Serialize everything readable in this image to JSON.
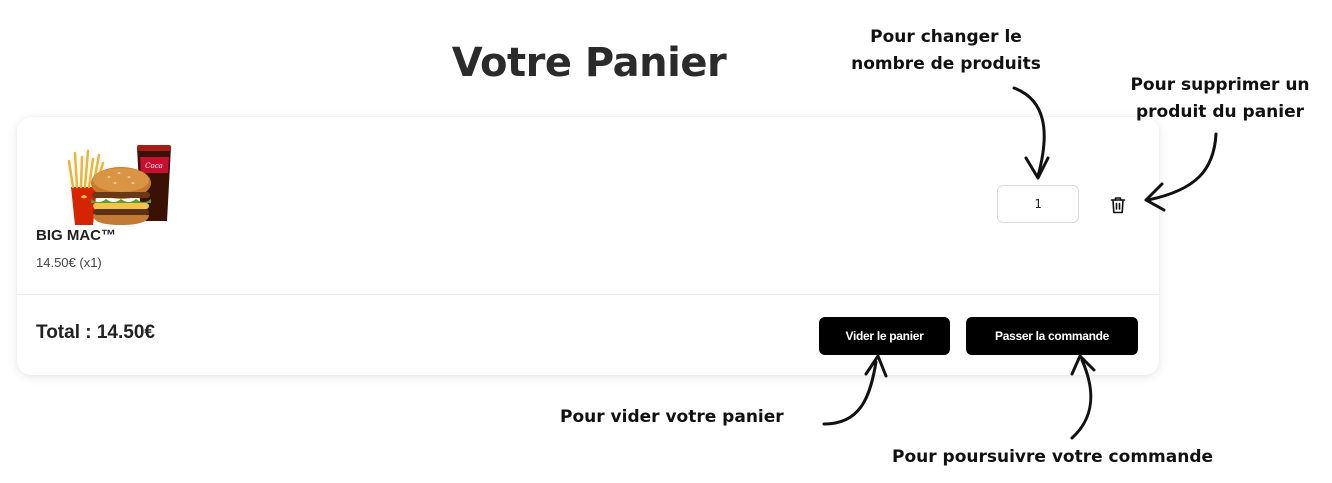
{
  "page": {
    "title": "Votre Panier"
  },
  "cart": {
    "items": [
      {
        "name": "BIG MAC™",
        "price_line": "14.50€ (x1)",
        "quantity": "1"
      }
    ],
    "total": "Total : 14.50€",
    "buttons": {
      "clear": "Vider le panier",
      "order": "Passer la commande"
    }
  },
  "annotations": {
    "quantity_note": "Pour changer le\nnombre de produits",
    "delete_note": "Pour supprimer un\nproduit du panier",
    "clear_note": "Pour vider votre panier",
    "order_note": "Pour poursuivre votre commande"
  },
  "icons": {
    "delete": "trash-icon",
    "product": "burger-menu-image"
  }
}
